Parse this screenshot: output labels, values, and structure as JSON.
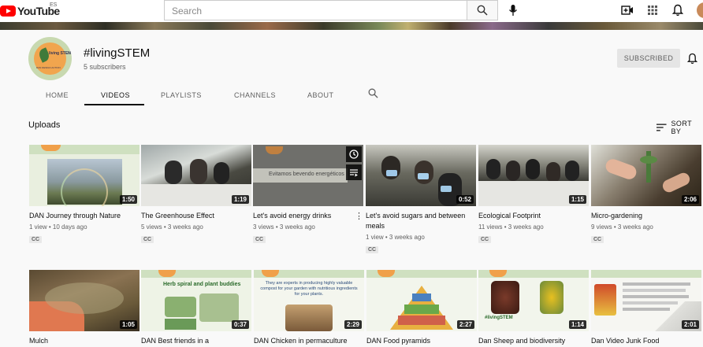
{
  "header": {
    "logo_text": "YouTube",
    "country": "ES",
    "search_placeholder": "Search"
  },
  "channel": {
    "name": "#livingSTEM",
    "subscribers": "5 subscribers",
    "subscribe_label": "SUBSCRIBED",
    "avatar_text": "living STEM",
    "avatar_small": "DAN DESIGN ACTION"
  },
  "tabs": [
    "HOME",
    "VIDEOS",
    "PLAYLISTS",
    "CHANNELS",
    "ABOUT"
  ],
  "active_tab": "VIDEOS",
  "section": {
    "title": "Uploads",
    "sort_label": "SORT BY"
  },
  "videos_row1": [
    {
      "title": "DAN Journey through Nature",
      "meta": "1 view • 10 days ago",
      "duration": "1:50",
      "cc": "CC"
    },
    {
      "title": "The Greenhouse Effect",
      "meta": "5 views • 3 weeks ago",
      "duration": "1:19",
      "cc": "CC"
    },
    {
      "title": "Let's avoid energy drinks",
      "meta": "3 views • 3 weeks ago",
      "duration": "",
      "cc": "CC",
      "thumb_text": "Evitamos bevendo energéticos"
    },
    {
      "title": "Let's avoid sugars and between meals",
      "meta": "1 view • 3 weeks ago",
      "duration": "0:52",
      "cc": "CC"
    },
    {
      "title": "Ecological Footprint",
      "meta": "11 views • 3 weeks ago",
      "duration": "1:15",
      "cc": "CC"
    },
    {
      "title": "Micro-gardening",
      "meta": "9 views • 3 weeks ago",
      "duration": "2:06",
      "cc": "CC"
    }
  ],
  "videos_row2": [
    {
      "title": "Mulch",
      "duration": "1:05"
    },
    {
      "title": "DAN Best friends in a",
      "duration": "0:37",
      "thumb_text": "Herb spiral and plant buddies"
    },
    {
      "title": "DAN Chicken in permaculture",
      "duration": "2:29",
      "thumb_text": "They are experts in producing highly valuable compost for your garden with nutritious ingredients for your plants."
    },
    {
      "title": "DAN Food pyramids",
      "duration": "2:27"
    },
    {
      "title": "Dan Sheep and biodiversity",
      "duration": "1:14",
      "thumb_text": "#livingSTEM"
    },
    {
      "title": "Dan Video Junk Food",
      "duration": "2:01"
    }
  ]
}
